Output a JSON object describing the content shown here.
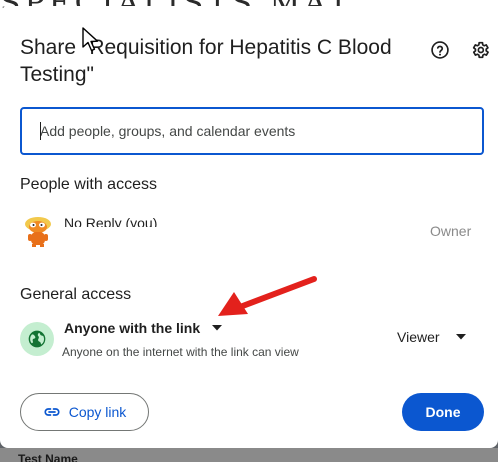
{
  "background": {
    "top_text": "SPECIALISTS MAT",
    "bottom_text": "Test Name"
  },
  "dialog": {
    "title": "Share \"Requisition for Hepatitis C Blood Testing\"",
    "help_icon": "help-circle-icon",
    "settings_icon": "gear-icon"
  },
  "search": {
    "placeholder": "Add people, groups, and calendar events",
    "value": ""
  },
  "people_section": {
    "heading": "People with access",
    "people": [
      {
        "name": "No Reply (you)",
        "role": "Owner",
        "avatar": "lorax-avatar"
      }
    ]
  },
  "general_access": {
    "heading": "General access",
    "icon": "globe-icon",
    "selected": "Anyone with the link",
    "description": "Anyone on the internet with the link can view",
    "role": "Viewer"
  },
  "footer": {
    "copy_link_label": "Copy link",
    "copy_link_icon": "link-icon",
    "done_label": "Done"
  },
  "colors": {
    "accent": "#0b57d0",
    "globe_bg": "#c4eed0",
    "globe_fg": "#137333",
    "annotation_arrow": "#e3211c"
  }
}
